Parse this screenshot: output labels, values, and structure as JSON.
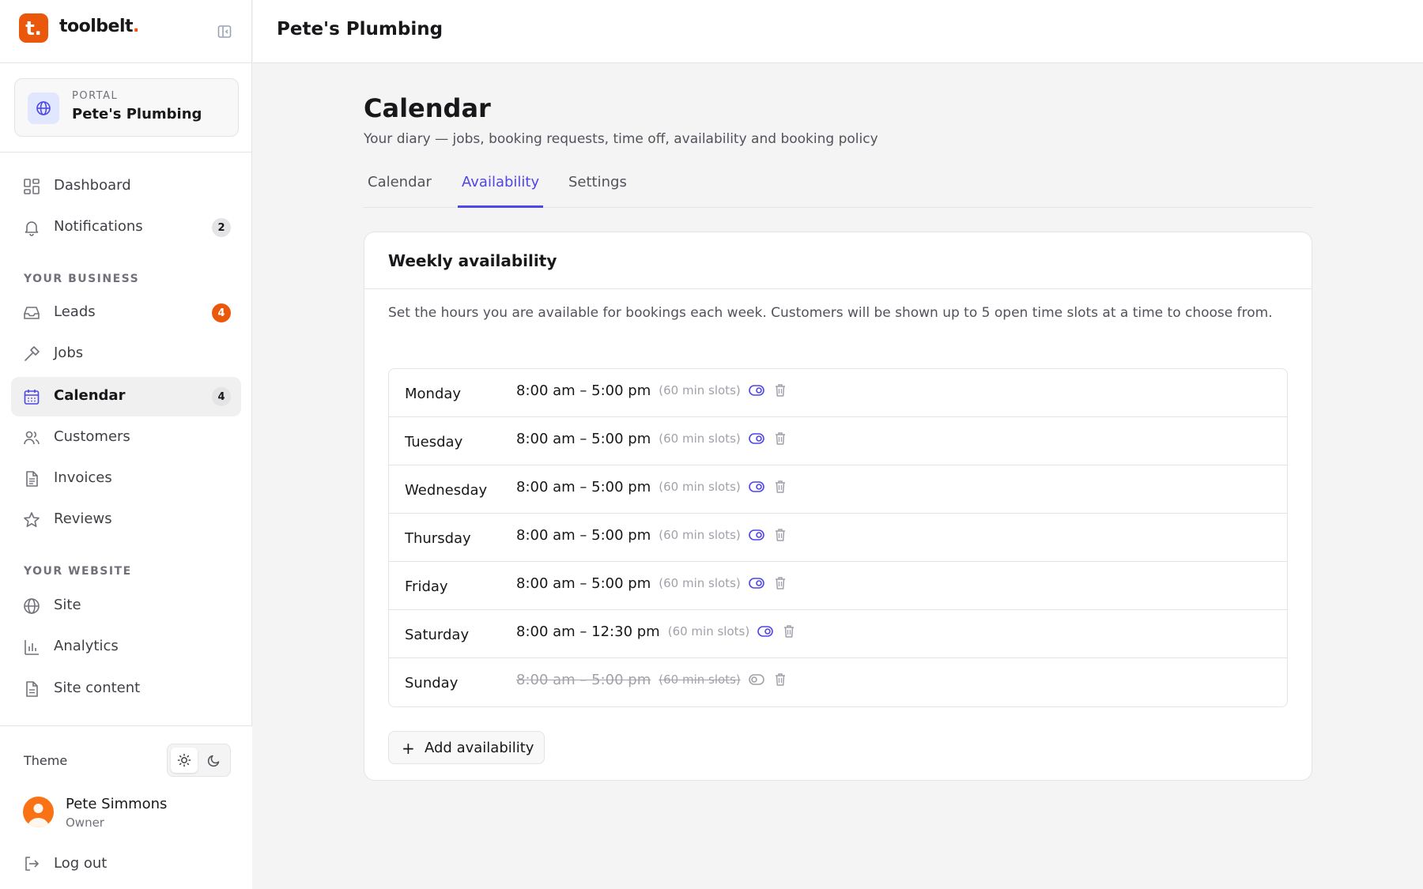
{
  "app": {
    "brand_name": "toolbelt",
    "brand_dot": ".",
    "logo_letter": "t"
  },
  "portal": {
    "label": "PORTAL",
    "name": "Pete's Plumbing"
  },
  "sidebar": {
    "items": [
      {
        "label": "Dashboard",
        "icon": "dashboard-icon"
      },
      {
        "label": "Notifications",
        "icon": "bell-icon",
        "badge": "2"
      },
      {
        "label": "Leads",
        "icon": "inbox-icon",
        "badge": "4"
      },
      {
        "label": "Jobs",
        "icon": "hammer-icon"
      },
      {
        "label": "Calendar",
        "icon": "calendar-icon",
        "badge": "4",
        "active": true
      },
      {
        "label": "Customers",
        "icon": "users-icon"
      },
      {
        "label": "Invoices",
        "icon": "file-icon"
      },
      {
        "label": "Reviews",
        "icon": "star-icon"
      },
      {
        "label": "Site",
        "icon": "globe-icon"
      },
      {
        "label": "Analytics",
        "icon": "bar-chart-icon"
      },
      {
        "label": "Site content",
        "icon": "document-icon"
      }
    ],
    "sections": {
      "business": "YOUR BUSINESS",
      "website": "YOUR WEBSITE"
    }
  },
  "theme": {
    "label": "Theme",
    "selected": "light"
  },
  "user": {
    "name": "Pete Simmons",
    "role": "Owner",
    "logout_label": "Log out"
  },
  "topbar": {
    "title": "Pete's Plumbing"
  },
  "page": {
    "title": "Calendar",
    "subtitle": "Your diary — jobs, booking requests, time off, availability and booking policy",
    "tabs": [
      {
        "label": "Calendar"
      },
      {
        "label": "Availability",
        "active": true
      },
      {
        "label": "Settings"
      }
    ]
  },
  "availability": {
    "card_title": "Weekly availability",
    "description": "Set the hours you are available for bookings each week. Customers will be shown up to 5 open time slots at a time to choose from.",
    "days": [
      {
        "day": "Monday",
        "time": "8:00 am – 5:00 pm",
        "slots": "(60 min slots)",
        "enabled": true
      },
      {
        "day": "Tuesday",
        "time": "8:00 am – 5:00 pm",
        "slots": "(60 min slots)",
        "enabled": true
      },
      {
        "day": "Wednesday",
        "time": "8:00 am – 5:00 pm",
        "slots": "(60 min slots)",
        "enabled": true
      },
      {
        "day": "Thursday",
        "time": "8:00 am – 5:00 pm",
        "slots": "(60 min slots)",
        "enabled": true
      },
      {
        "day": "Friday",
        "time": "8:00 am – 5:00 pm",
        "slots": "(60 min slots)",
        "enabled": true
      },
      {
        "day": "Saturday",
        "time": "8:00 am – 12:30 pm",
        "slots": "(60 min slots)",
        "enabled": true
      },
      {
        "day": "Sunday",
        "time": "8:00 am – 5:00 pm",
        "slots": "(60 min slots)",
        "enabled": false
      }
    ],
    "add_label": "Add availability"
  },
  "colors": {
    "brand": "#ea580c",
    "accent": "#4f46e5",
    "badge_orange": "#ea580c"
  }
}
